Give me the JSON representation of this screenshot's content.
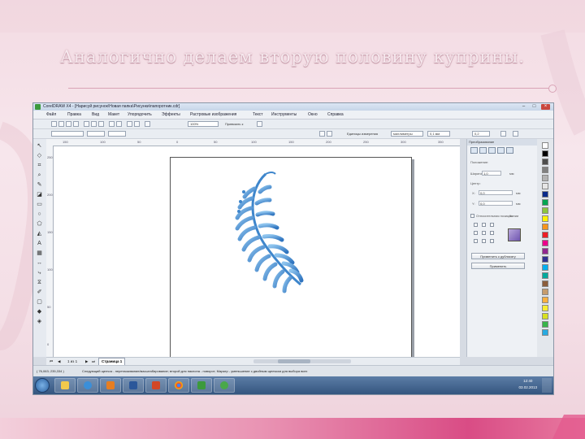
{
  "slide": {
    "title": "Аналогично делаем вторую половину куприны."
  },
  "window": {
    "title": "CorelDRAW X4 - [Нарисуй рисунок\\Новая папка\\Рисунки\\папоротник.cdr]",
    "min_label": "–",
    "max_label": "□",
    "close_label": "×"
  },
  "menu": [
    "Файл",
    "Правка",
    "Вид",
    "Макет",
    "Упорядочить",
    "Эффекты",
    "Растровые изображения",
    "Текст",
    "Инструменты",
    "Окно",
    "Справка"
  ],
  "toolbar": {
    "zoom": "100%",
    "snap": "Привязать к",
    "units_label": "Единицы измерения",
    "units": "миллиметры",
    "nudge": "0,1 мм",
    "outline_width": "0,2"
  },
  "ruler_h": [
    "150",
    "100",
    "50",
    "0",
    "50",
    "100",
    "150",
    "200",
    "250",
    "300",
    "350"
  ],
  "ruler_v": [
    "250",
    "200",
    "150",
    "100",
    "50",
    "0"
  ],
  "docker": {
    "header": "Преобразование",
    "section_pos": "Положение:",
    "width_label": "Ширина:",
    "width_value": "1,0",
    "center_label": "Центр:",
    "x_label": "X:",
    "x_value": "0,0",
    "y_label": "Y:",
    "y_value": "0,0",
    "relative_label": "Относительная позиция",
    "copies_label": "Копии",
    "apply_to_duplicate": "Применить к дубликату",
    "apply": "Применить",
    "mm": "мм"
  },
  "page_nav": {
    "count": "1 из 1",
    "tab": "Страница 1"
  },
  "status": {
    "coords": "( 76,063; 235,334 )",
    "hint": "Следующий щелчок - перетаскивание/масштабирование; второй для наклона - поворот; Маркер - уменьшение с двойным щелчком для выбора всех"
  },
  "taskbar": {
    "time": "12:40",
    "date": "03.02.2013"
  },
  "colors": {
    "fern": "#4a8fd1",
    "bottom_band": "#d94c85"
  }
}
